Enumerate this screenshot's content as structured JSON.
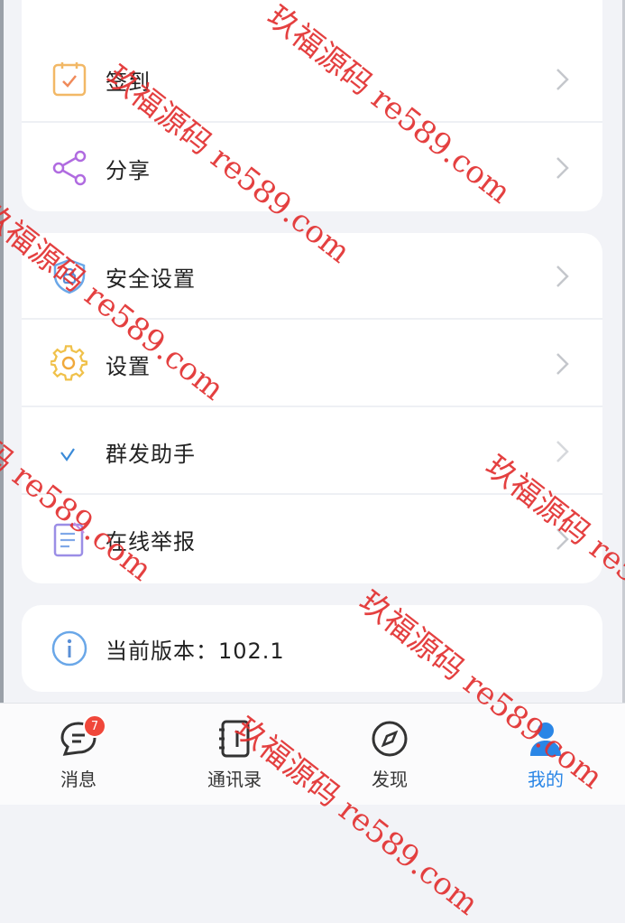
{
  "menu_top": [
    {
      "label": "签到",
      "icon": "checkin-icon"
    },
    {
      "label": "分享",
      "icon": "share-icon"
    }
  ],
  "menu_mid": [
    {
      "label": "安全设置",
      "icon": "shield-icon"
    },
    {
      "label": "设置",
      "icon": "gear-icon"
    },
    {
      "label": "群发助手",
      "icon": "broadcast-icon"
    },
    {
      "label": "在线举报",
      "icon": "report-icon"
    }
  ],
  "version": {
    "label": "当前版本：102.1",
    "icon": "info-icon"
  },
  "tabbar": {
    "tabs": [
      {
        "label": "消息",
        "icon": "message-icon",
        "badge": "7"
      },
      {
        "label": "通讯录",
        "icon": "contacts-icon"
      },
      {
        "label": "发现",
        "icon": "compass-icon"
      },
      {
        "label": "我的",
        "icon": "profile-icon",
        "active": true
      }
    ]
  },
  "watermark": {
    "text": "玖福源码 re589.com"
  },
  "colors": {
    "accent": "#2a86e6",
    "badge": "#f0473a",
    "watermark": "#e23030"
  }
}
